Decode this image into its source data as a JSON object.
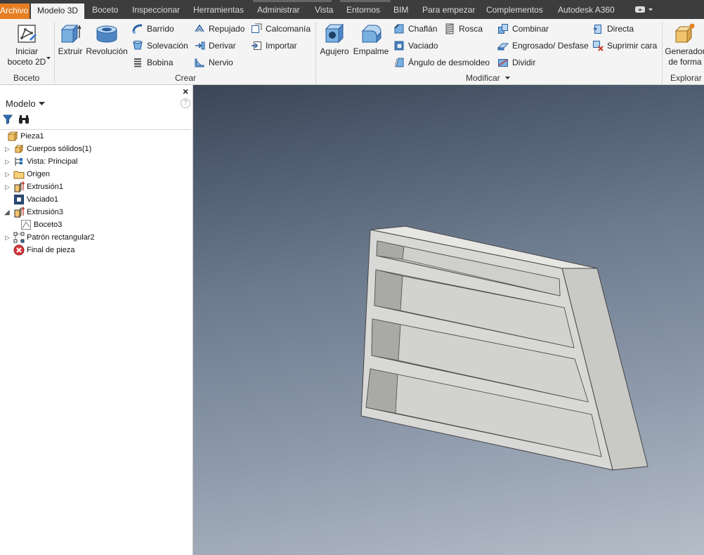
{
  "menubar": {
    "file_tab": "Archivo",
    "tabs": [
      "Modelo 3D",
      "Boceto",
      "Inspeccionar",
      "Herramientas",
      "Administrar",
      "Vista",
      "Entornos",
      "BIM",
      "Para empezar",
      "Complementos",
      "Autodesk A360"
    ],
    "file_tab_color": "#e67e22",
    "bar_color": "#3d3d3d"
  },
  "ribbon": {
    "boceto": {
      "title": "Boceto",
      "start_sketch": "Iniciar\nboceto 2D"
    },
    "crear": {
      "title": "Crear",
      "extrude": "Extruir",
      "revolve": "Revolución",
      "sweep": "Barrido",
      "loft": "Solevación",
      "coil": "Bobina",
      "emboss": "Repujado",
      "derive": "Derivar",
      "rib": "Nervio",
      "decal": "Calcomanía",
      "import": "Importar"
    },
    "modificar": {
      "title": "Modificar",
      "hole": "Agujero",
      "fillet": "Empalme",
      "chamfer": "Chaflán",
      "thread": "Rosca",
      "shell": "Vaciado",
      "draft": "Ángulo de desmoldeo",
      "combine": "Combinar",
      "thicken": "Engrosado/ Desfase",
      "split": "Dividir",
      "direct": "Directa",
      "delete_face": "Suprimir cara"
    },
    "explorar": {
      "title": "Explorar",
      "shape_generator": "Generador\nde forma"
    }
  },
  "browser": {
    "title": "Modelo",
    "help": "?",
    "close": "×",
    "tree": [
      "Pieza1",
      "Cuerpos sólidos(1)",
      "Vista: Principal",
      "Origen",
      "Extrusión1",
      "Vaciado1",
      "Extrusión3",
      "Boceto3",
      "Patrón rectangular2",
      "Final de pieza"
    ]
  },
  "viewport": {
    "gradient_top": "#3b4658",
    "gradient_bottom": "#b5bdc7",
    "part_color": "#d8d8d6"
  }
}
